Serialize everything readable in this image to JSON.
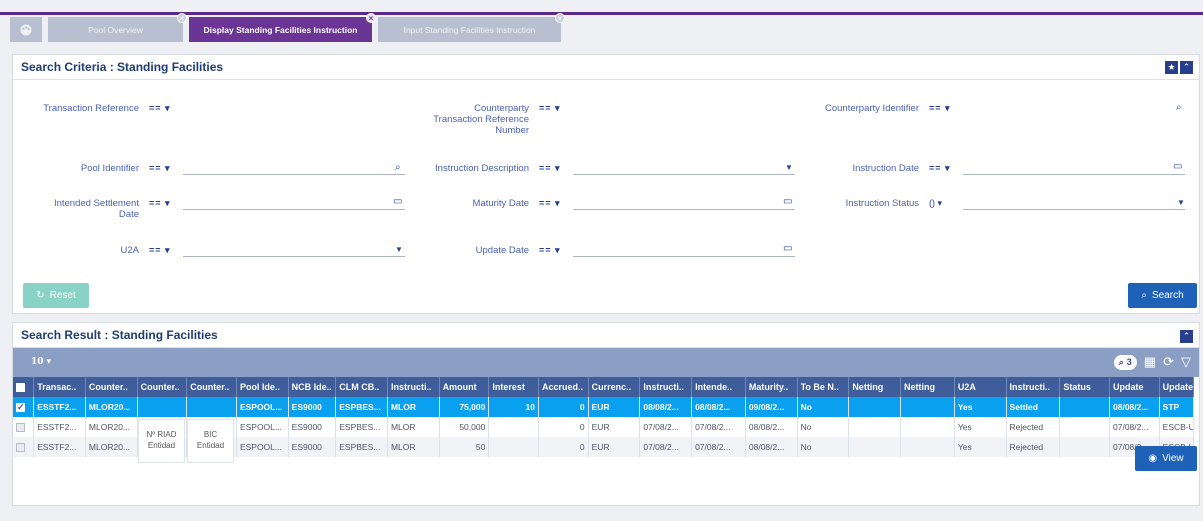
{
  "tabs": [
    {
      "label": "",
      "icon": "palette-icon"
    },
    {
      "label": "Pool Overview"
    },
    {
      "label": "Display Standing Facilities Instruction"
    },
    {
      "label": "Input Standing Facilities Instruction"
    }
  ],
  "criteria": {
    "title": "Search Criteria : Standing Facilities",
    "operator": "==",
    "status_operator": "()",
    "fields": {
      "transaction_reference": "Transaction Reference",
      "counterparty_transaction_reference": "Counterparty\nTransaction Reference\nNumber",
      "counterparty_identifier": "Counterparty Identifier",
      "pool_identifier": "Pool Identifier",
      "instruction_description": "Instruction Description",
      "instruction_date": "Instruction Date",
      "intended_settlement_date": "Intended Settlement\nDate",
      "maturity_date": "Maturity Date",
      "instruction_status": "Instruction Status",
      "u2a": "U2A",
      "update_date": "Update Date"
    },
    "reset_label": "Reset",
    "search_label": "Search"
  },
  "results": {
    "title": "Search Result : Standing Facilities",
    "page_size": "10",
    "query_count": "3",
    "columns": [
      "Transac..",
      "Counter..",
      "Counter..",
      "Counter..",
      "Pool Ide..",
      "NCB Ide..",
      "CLM CB..",
      "Instructi..",
      "Amount",
      "Interest",
      "Accrued..",
      "Currenc..",
      "Instructi..",
      "Intende..",
      "Maturity..",
      "To Be N..",
      "Netting",
      "Netting",
      "U2A",
      "Instructi..",
      "Status",
      "Update",
      "Update"
    ],
    "rows": [
      [
        "ESSTF2...",
        "MLOR20...",
        "",
        "",
        "ESPOOL...",
        "ES9000",
        "ESPBES...",
        "MLOR",
        "75,000",
        "10",
        "0",
        "EUR",
        "08/08/2...",
        "08/08/2...",
        "09/08/2...",
        "No",
        "",
        "",
        "Yes",
        "Settled",
        "",
        "08/08/2...",
        "STP"
      ],
      [
        "ESSTF2...",
        "MLOR20...",
        "",
        "",
        "ESPOOL...",
        "ES9000",
        "ESPBES...",
        "MLOR",
        "50,000",
        "",
        "0",
        "EUR",
        "07/08/2...",
        "07/08/2...",
        "08/08/2...",
        "No",
        "",
        "",
        "Yes",
        "Rejected",
        "",
        "07/08/2...",
        "ESCB-U..."
      ],
      [
        "ESSTF2...",
        "MLOR20...",
        "",
        "",
        "ESPOOL...",
        "ES9000",
        "ESPBES...",
        "MLOR",
        "50",
        "",
        "0",
        "EUR",
        "07/08/2...",
        "07/08/2...",
        "08/08/2...",
        "No",
        "",
        "",
        "Yes",
        "Rejected",
        "",
        "07/08/2...",
        "ESCB-U..."
      ]
    ],
    "tooltip_riad": "Nº RIAD\nEntidad",
    "tooltip_bic": "BIC\nEntidad",
    "view_label": "View"
  }
}
